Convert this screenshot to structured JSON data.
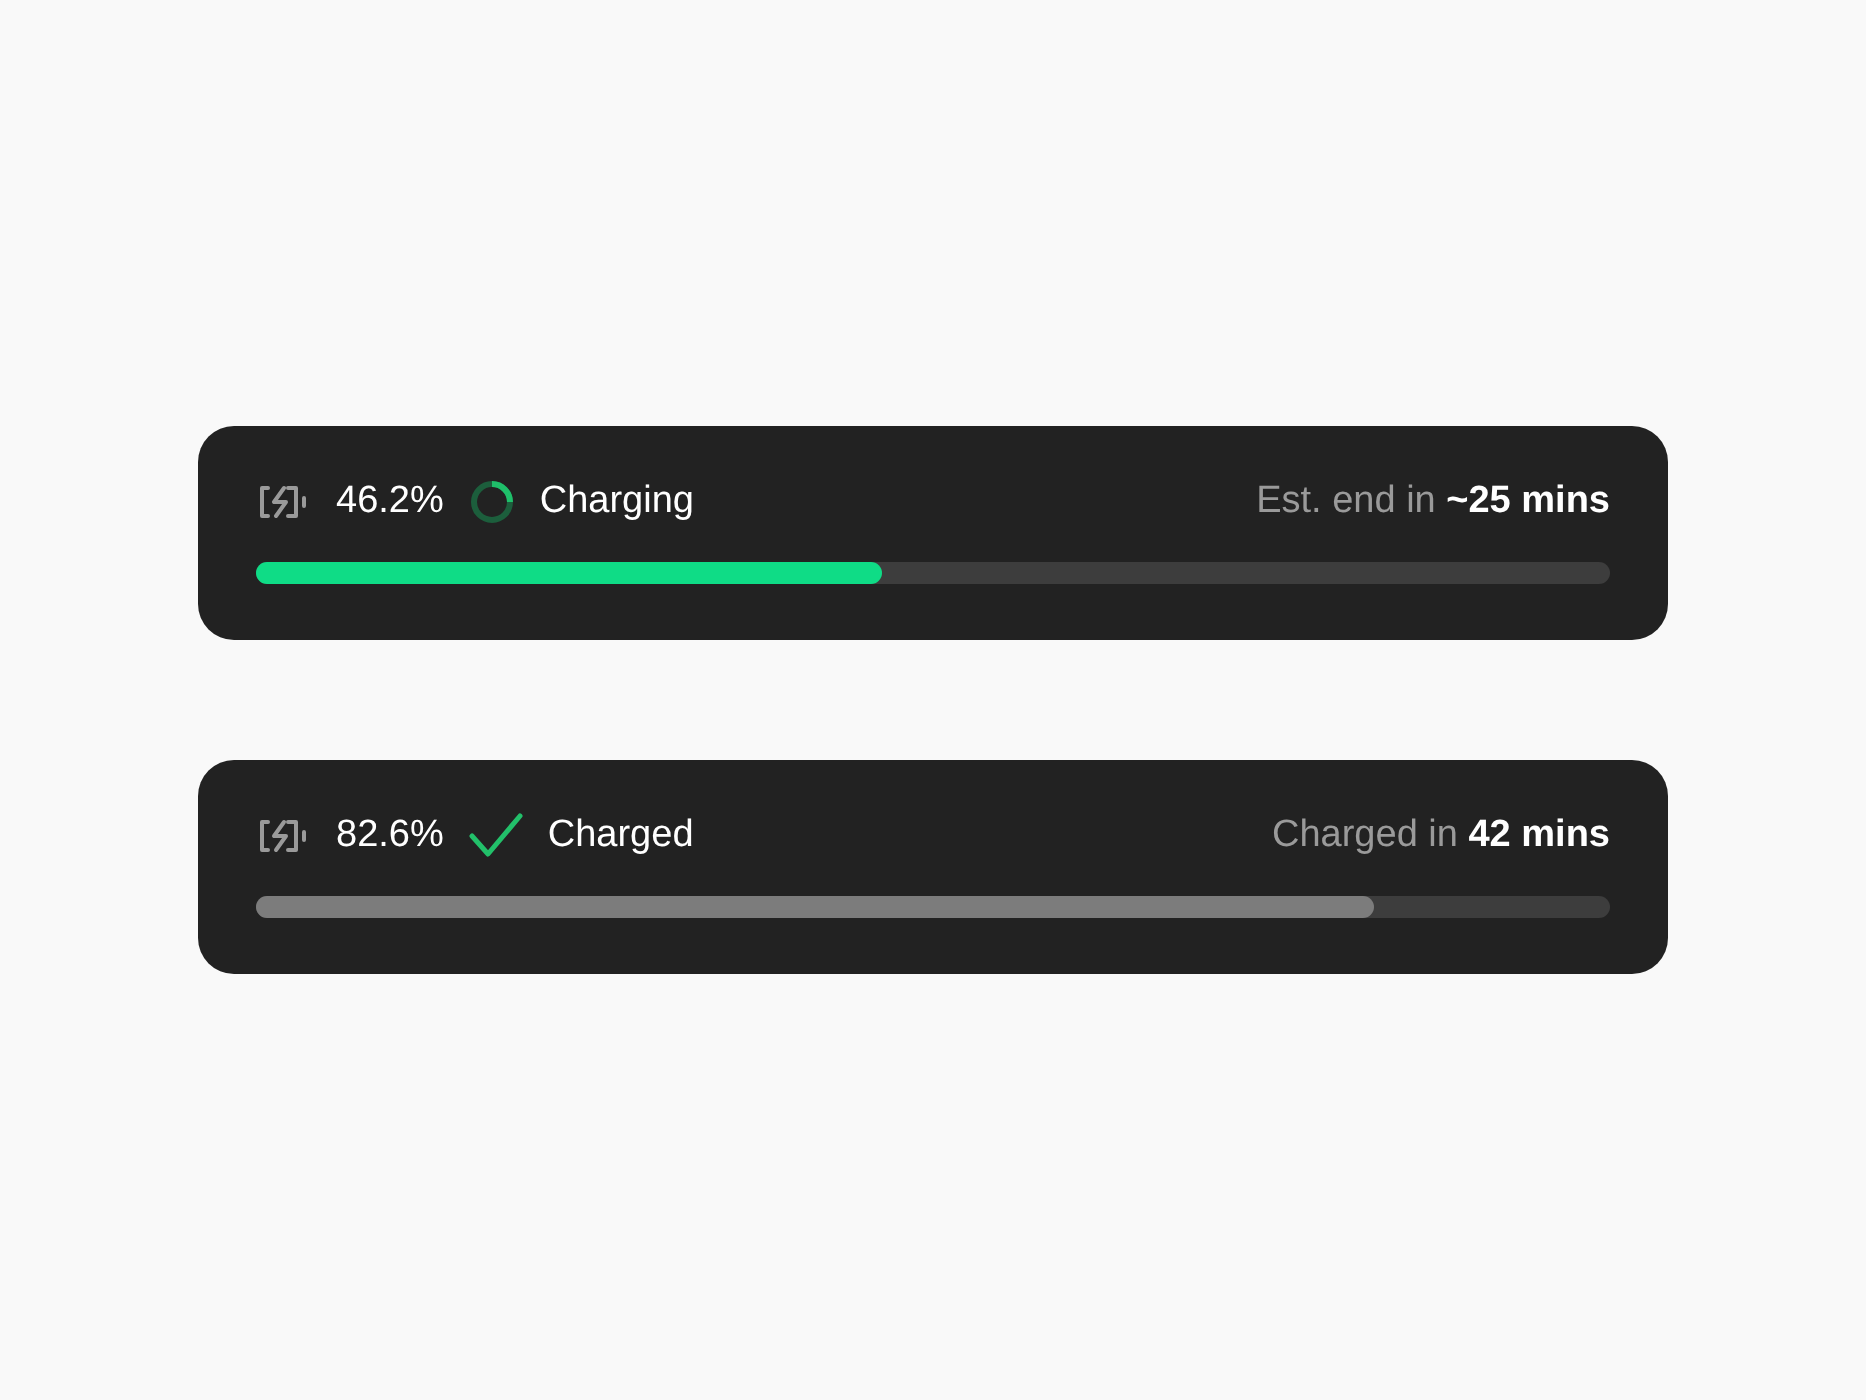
{
  "cards": [
    {
      "kind": "charging",
      "percent": "46.2%",
      "status": "Charging",
      "estimate": "Est. end in **~25 mins**",
      "level": 0.462
    },
    {
      "kind": "charged",
      "percent": "82.6%",
      "status": "Charged",
      "estimate": "Charged in **42 mins**",
      "level": 0.826
    }
  ]
}
